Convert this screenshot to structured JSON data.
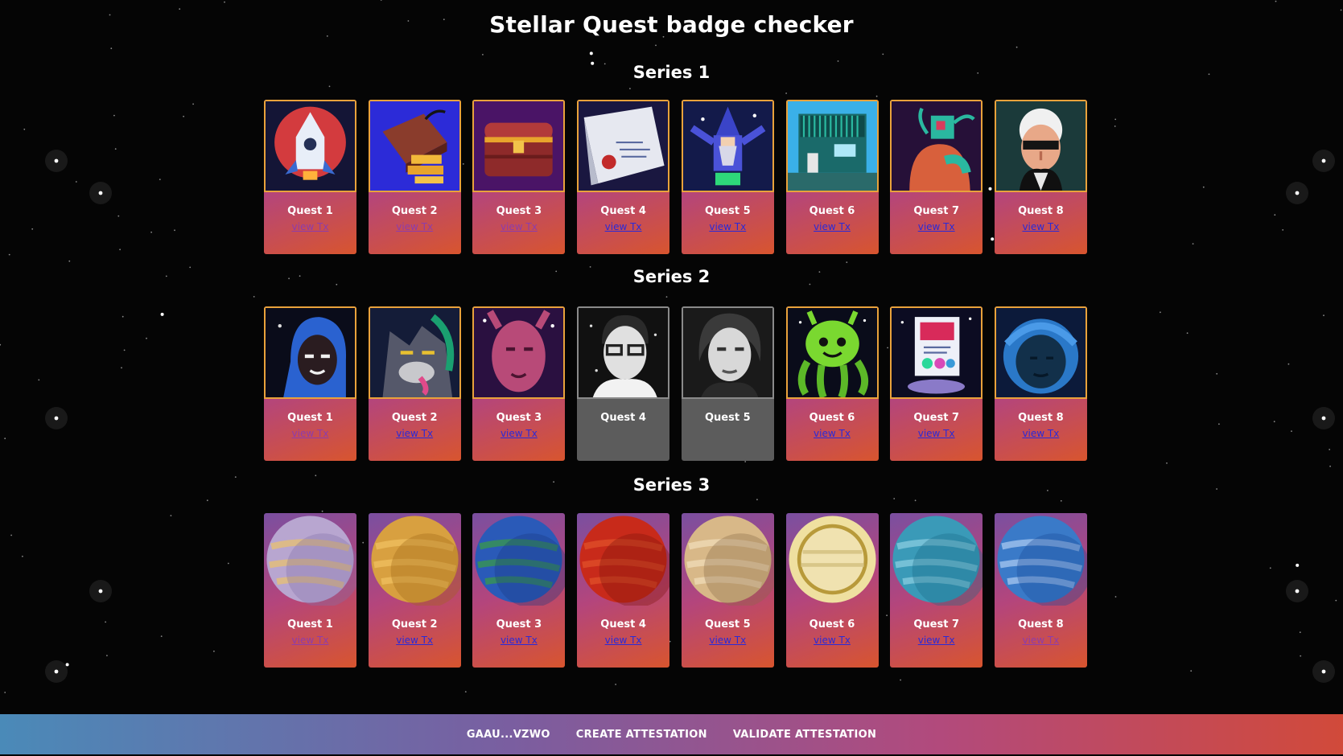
{
  "title": "Stellar Quest badge checker",
  "series": [
    {
      "title": "Series 1",
      "cards": [
        {
          "name": "Quest 1",
          "link": "view Tx",
          "state": "visited",
          "art": "rocket-icon"
        },
        {
          "name": "Quest 2",
          "link": "view Tx",
          "state": "visited",
          "art": "gold-bars-icon"
        },
        {
          "name": "Quest 3",
          "link": "view Tx",
          "state": "visited",
          "art": "treasure-chest-icon"
        },
        {
          "name": "Quest 4",
          "link": "view Tx",
          "state": "link",
          "art": "scroll-icon"
        },
        {
          "name": "Quest 5",
          "link": "view Tx",
          "state": "link",
          "art": "wizard-icon"
        },
        {
          "name": "Quest 6",
          "link": "view Tx",
          "state": "link",
          "art": "building-icon"
        },
        {
          "name": "Quest 7",
          "link": "view Tx",
          "state": "link",
          "art": "creature-icon"
        },
        {
          "name": "Quest 8",
          "link": "view Tx",
          "state": "link",
          "art": "portrait-icon"
        }
      ]
    },
    {
      "title": "Series 2",
      "cards": [
        {
          "name": "Quest 1",
          "link": "view Tx",
          "state": "visited",
          "art": "astronaut-portrait-icon"
        },
        {
          "name": "Quest 2",
          "link": "view Tx",
          "state": "link",
          "art": "wolf-portrait-icon"
        },
        {
          "name": "Quest 3",
          "link": "view Tx",
          "state": "link",
          "art": "alien-portrait-icon"
        },
        {
          "name": "Quest 4",
          "link": "",
          "state": "locked",
          "art": "glasses-portrait-icon"
        },
        {
          "name": "Quest 5",
          "link": "",
          "state": "locked",
          "art": "woman-portrait-icon"
        },
        {
          "name": "Quest 6",
          "link": "view Tx",
          "state": "link",
          "art": "octopus-icon"
        },
        {
          "name": "Quest 7",
          "link": "view Tx",
          "state": "link",
          "art": "book-icon"
        },
        {
          "name": "Quest 8",
          "link": "view Tx",
          "state": "link",
          "art": "helmet-portrait-icon"
        }
      ]
    },
    {
      "title": "Series 3",
      "cards": [
        {
          "name": "Quest 1",
          "link": "view Tx",
          "state": "visited",
          "art": "mercury-planet-icon"
        },
        {
          "name": "Quest 2",
          "link": "view Tx",
          "state": "link",
          "art": "venus-planet-icon"
        },
        {
          "name": "Quest 3",
          "link": "view Tx",
          "state": "link",
          "art": "earth-planet-icon"
        },
        {
          "name": "Quest 4",
          "link": "view Tx",
          "state": "link",
          "art": "mars-planet-icon"
        },
        {
          "name": "Quest 5",
          "link": "view Tx",
          "state": "link",
          "art": "jupiter-planet-icon"
        },
        {
          "name": "Quest 6",
          "link": "view Tx",
          "state": "link",
          "art": "saturn-planet-icon"
        },
        {
          "name": "Quest 7",
          "link": "view Tx",
          "state": "link",
          "art": "uranus-planet-icon"
        },
        {
          "name": "Quest 8",
          "link": "view Tx",
          "state": "visited",
          "art": "neptune-planet-icon"
        }
      ]
    }
  ],
  "footer": {
    "account": "GAAU...VZWO",
    "create": "CREATE ATTESTATION",
    "validate": "VALIDATE ATTESTATION"
  },
  "colors": {
    "link": "#2a2ad8",
    "visited": "#8d3cab",
    "badge_border": "#e9a23b",
    "locked_card": "#5c5c5c"
  }
}
